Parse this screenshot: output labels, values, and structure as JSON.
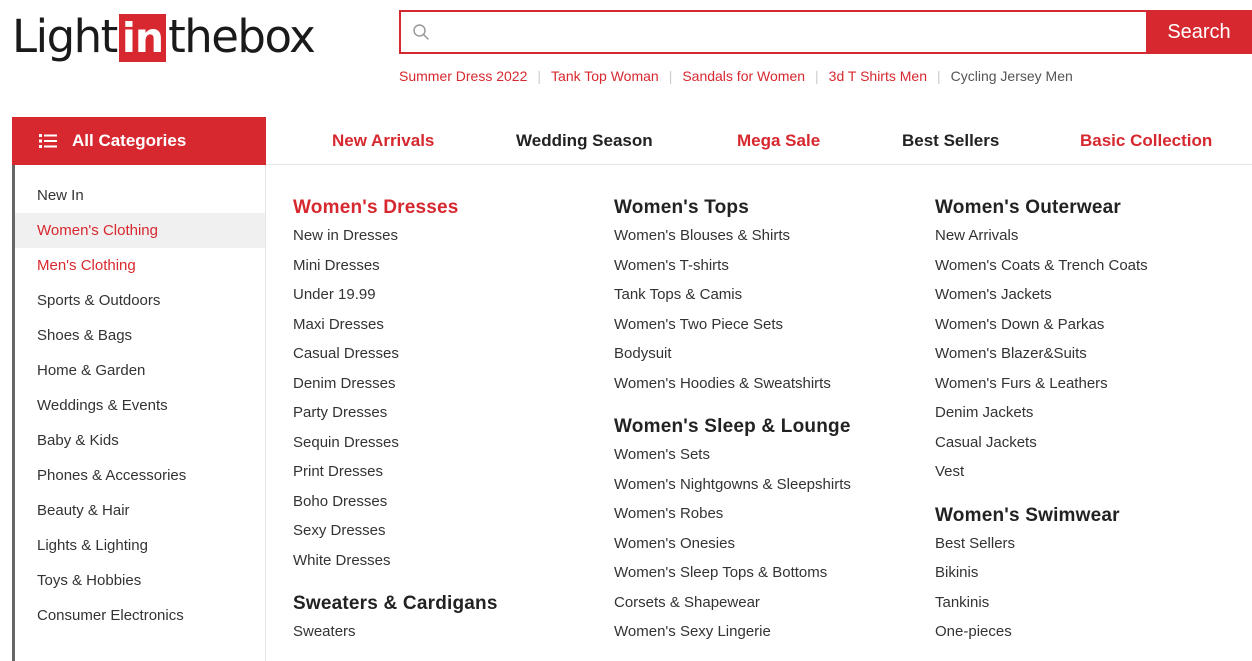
{
  "logo": {
    "part1": "Light",
    "part2": "in",
    "part3": "thebox"
  },
  "search": {
    "placeholder": "",
    "value": "",
    "button": "Search"
  },
  "hot_searches": [
    {
      "label": "Summer Dress 2022",
      "style": "red"
    },
    {
      "label": "Tank Top Woman",
      "style": "red"
    },
    {
      "label": "Sandals for Women",
      "style": "red"
    },
    {
      "label": "3d T Shirts Men",
      "style": "red"
    },
    {
      "label": "Cycling Jersey Men",
      "style": "gray"
    }
  ],
  "nav": {
    "all_categories": "All Categories",
    "items": [
      {
        "label": "New Arrivals",
        "color": "red"
      },
      {
        "label": "Wedding Season",
        "color": "dark"
      },
      {
        "label": "Mega Sale",
        "color": "red"
      },
      {
        "label": "Best Sellers",
        "color": "dark"
      },
      {
        "label": "Basic Collection",
        "color": "red"
      }
    ]
  },
  "sidebar": {
    "items": [
      {
        "label": "New In",
        "state": "normal"
      },
      {
        "label": "Women's Clothing",
        "state": "active"
      },
      {
        "label": "Men's Clothing",
        "state": "red"
      },
      {
        "label": "Sports & Outdoors",
        "state": "normal"
      },
      {
        "label": "Shoes & Bags",
        "state": "normal"
      },
      {
        "label": "Home & Garden",
        "state": "normal"
      },
      {
        "label": "Weddings & Events",
        "state": "normal"
      },
      {
        "label": "Baby & Kids",
        "state": "normal"
      },
      {
        "label": "Phones & Accessories",
        "state": "normal"
      },
      {
        "label": "Beauty & Hair",
        "state": "normal"
      },
      {
        "label": "Lights & Lighting",
        "state": "normal"
      },
      {
        "label": "Toys & Hobbies",
        "state": "normal"
      },
      {
        "label": "Consumer Electronics",
        "state": "normal"
      }
    ]
  },
  "menu": {
    "columns": [
      [
        {
          "title": "Women's Dresses",
          "highlight": true,
          "links": [
            "New in Dresses",
            "Mini Dresses",
            "Under 19.99",
            "Maxi Dresses",
            "Casual Dresses",
            "Denim Dresses",
            "Party Dresses",
            "Sequin Dresses",
            "Print Dresses",
            "Boho Dresses",
            "Sexy Dresses",
            "White Dresses"
          ]
        },
        {
          "title": "Sweaters & Cardigans",
          "highlight": false,
          "links": [
            "Sweaters"
          ]
        }
      ],
      [
        {
          "title": "Women's Tops",
          "highlight": false,
          "links": [
            "Women's Blouses & Shirts",
            "Women's T-shirts",
            "Tank Tops & Camis",
            "Women's Two Piece Sets",
            "Bodysuit",
            "Women's Hoodies & Sweatshirts"
          ]
        },
        {
          "title": "Women's Sleep & Lounge",
          "highlight": false,
          "links": [
            "Women's Sets",
            "Women's Nightgowns & Sleepshirts",
            "Women's Robes",
            "Women's Onesies",
            "Women's Sleep Tops & Bottoms",
            "Corsets & Shapewear",
            "Women's Sexy Lingerie"
          ]
        }
      ],
      [
        {
          "title": "Women's Outerwear",
          "highlight": false,
          "links": [
            "New Arrivals",
            "Women's Coats & Trench Coats",
            "Women's Jackets",
            "Women's Down & Parkas",
            "Women's Blazer&Suits",
            "Women's Furs & Leathers",
            "Denim Jackets",
            "Casual Jackets",
            "Vest"
          ]
        },
        {
          "title": "Women's Swimwear",
          "highlight": false,
          "links": [
            "Best Sellers",
            "Bikinis",
            "Tankinis",
            "One-pieces"
          ]
        }
      ]
    ]
  },
  "colors": {
    "brand_red": "#d7282f",
    "text": "#333333",
    "active_bg": "#f0f0f0"
  },
  "icons": {
    "search": "search-icon",
    "menu": "hamburger-menu-icon"
  }
}
